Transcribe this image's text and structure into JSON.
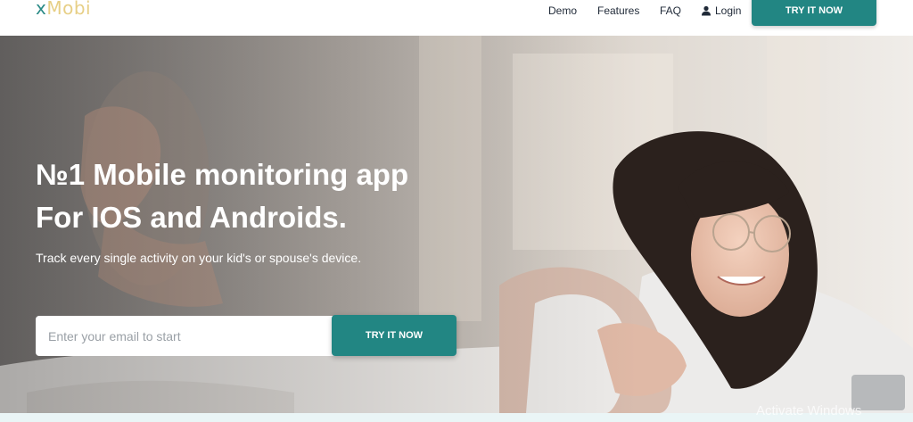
{
  "brand": {
    "logo_x": "x",
    "logo_rest": "Mobi"
  },
  "nav": {
    "demo": "Demo",
    "features": "Features",
    "faq": "FAQ",
    "login": "Login",
    "cta": "TRY IT NOW"
  },
  "hero": {
    "title_line1": "№1 Mobile monitoring app",
    "title_line2": "For IOS and Androids.",
    "subtitle": "Track every single activity on your kid's or spouse's device.",
    "email_placeholder": "Enter your email to start",
    "cta": "TRY IT NOW"
  },
  "watermark": "Activate Windows",
  "colors": {
    "accent": "#228683",
    "logo_x": "#2a8a86",
    "logo_rest": "#e7cf86",
    "bottom_strip": "#eaf5f6"
  },
  "icons": {
    "login": "user-icon"
  }
}
